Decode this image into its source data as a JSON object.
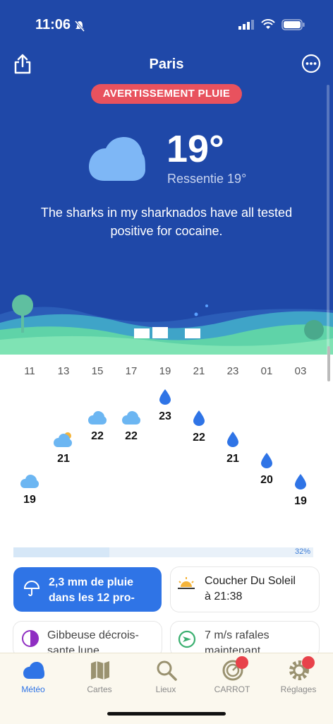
{
  "status": {
    "time": "11:06"
  },
  "header": {
    "city": "Paris"
  },
  "alert": {
    "label": "AVERTISSEMENT PLUIE"
  },
  "current": {
    "temp": "19°",
    "feels_like": "Ressentie 19°",
    "quip": "The sharks in my sharknados have all tested positive for cocaine."
  },
  "hourly": {
    "hours": [
      "11",
      "13",
      "15",
      "17",
      "19",
      "21",
      "23",
      "01",
      "03"
    ],
    "temps": [
      "19",
      "21",
      "22",
      "22",
      "23",
      "22",
      "21",
      "20",
      "19"
    ],
    "icons": [
      "cloud-icon",
      "partly-sunny-icon",
      "cloud-icon",
      "cloud-icon",
      "raindrop-icon",
      "raindrop-icon",
      "raindrop-icon",
      "raindrop-icon",
      "raindrop-icon"
    ]
  },
  "precip": {
    "chance": "32%",
    "fill_fraction": 0.32
  },
  "cards": {
    "rain": {
      "line1": "2,3 mm de pluie",
      "line2": "dans les 12 pro-"
    },
    "sunset": {
      "line1": "Coucher Du Soleil",
      "line2": "à 21:38"
    },
    "moon": {
      "line1": "Gibbeuse décrois-",
      "line2": "sante lune"
    },
    "wind": {
      "line1": "7 m/s rafales",
      "line2": "maintenant"
    }
  },
  "tabs": [
    {
      "label": "Météo"
    },
    {
      "label": "Cartes"
    },
    {
      "label": "Lieux"
    },
    {
      "label": "CARROT"
    },
    {
      "label": "Réglages"
    }
  ],
  "colors": {
    "hero": "#1f48a8",
    "alert": "#e8525e",
    "accent": "#2f74e6",
    "raindrop": "#2f74e6",
    "cloud": "#6cb6f2"
  }
}
